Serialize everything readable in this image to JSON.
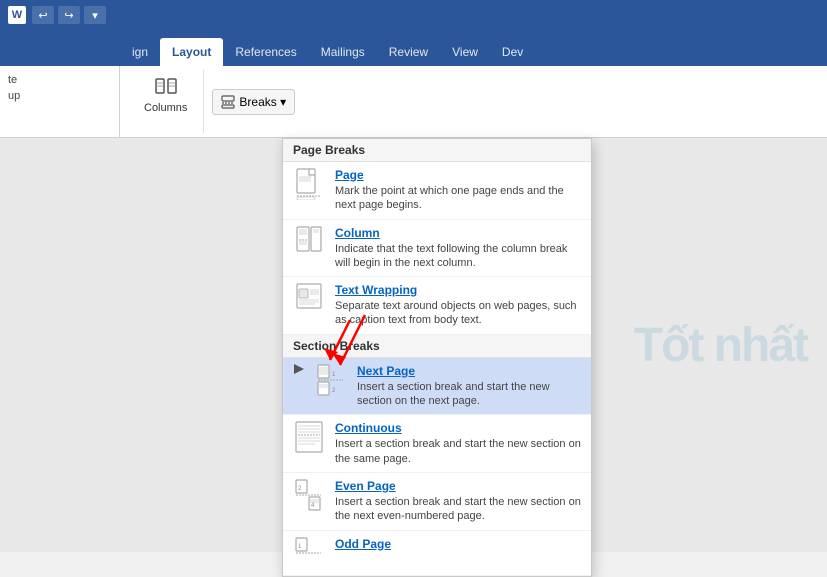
{
  "titlebar": {
    "icon": "W",
    "tools": [
      "↩",
      "↪",
      "▾"
    ]
  },
  "tabs": [
    {
      "label": "ign",
      "active": false
    },
    {
      "label": "Layout",
      "active": true
    },
    {
      "label": "References",
      "active": false
    },
    {
      "label": "Mailings",
      "active": false
    },
    {
      "label": "Review",
      "active": false
    },
    {
      "label": "View",
      "active": false
    },
    {
      "label": "Dev",
      "active": false
    }
  ],
  "ribbon": {
    "partial_items": [
      "te",
      "up"
    ],
    "columns_label": "Columns",
    "breaks_label": "Breaks ▾",
    "breaks_button": "Breaks"
  },
  "dropdown": {
    "section1_header": "Page Breaks",
    "section2_header": "Section Breaks",
    "items_page": [
      {
        "id": "page",
        "title": "Page",
        "desc": "Mark the point at which one page ends\nand the next page begins."
      },
      {
        "id": "column",
        "title": "Column",
        "desc": "Indicate that the text following the column\nbreak will begin in the next column."
      },
      {
        "id": "text-wrapping",
        "title": "Text Wrapping",
        "desc": "Separate text around objects on web\npages, such as caption text from body text."
      }
    ],
    "items_section": [
      {
        "id": "next-page",
        "title": "Next Page",
        "desc": "Insert a section break and start the new\nsection on the next page.",
        "selected": true
      },
      {
        "id": "continuous",
        "title": "Continuous",
        "desc": "Insert a section break and start the new\nsection on the same page."
      },
      {
        "id": "even-page",
        "title": "Even Page",
        "desc": "Insert a section break and start the new\nsection on the next even-numbered page."
      },
      {
        "id": "odd-page",
        "title": "Odd Page",
        "desc": ""
      }
    ]
  },
  "doc_watermark": "Tốt nhất"
}
